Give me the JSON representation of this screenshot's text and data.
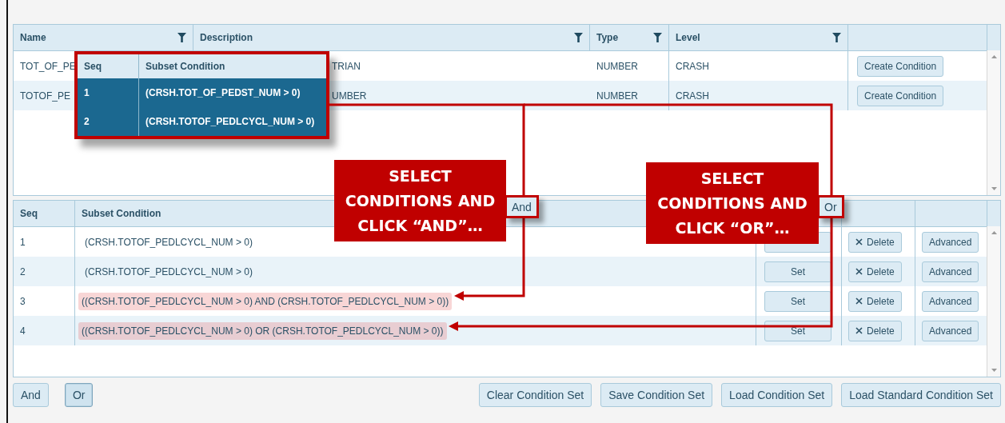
{
  "top_grid": {
    "columns": [
      {
        "label": "Name",
        "filter": true
      },
      {
        "label": "Description",
        "filter": true
      },
      {
        "label": "Type",
        "filter": true
      },
      {
        "label": "Level",
        "filter": true
      }
    ],
    "rows": [
      {
        "name": "TOT_OF_PE",
        "description": "TRIAN",
        "type": "NUMBER",
        "level": "CRASH",
        "action": "Create Condition"
      },
      {
        "name": "TOTOF_PE",
        "description": "UMBER",
        "type": "NUMBER",
        "level": "CRASH",
        "action": "Create Condition"
      }
    ]
  },
  "popup": {
    "columns": [
      "Seq",
      "Subset Condition"
    ],
    "rows": [
      {
        "seq": "1",
        "condition": "(CRSH.TOT_OF_PEDST_NUM > 0)",
        "selected": true
      },
      {
        "seq": "2",
        "condition": "(CRSH.TOTOF_PEDLCYCL_NUM > 0)",
        "selected": true
      }
    ]
  },
  "condition_grid": {
    "columns": [
      "Seq",
      "Subset Condition"
    ],
    "rows": [
      {
        "seq": "1",
        "condition": "(CRSH.TOTOF_PEDLCYCL_NUM > 0)",
        "highlighted": false,
        "delete": "Delete",
        "advanced": "Advanced"
      },
      {
        "seq": "2",
        "condition": "(CRSH.TOTOF_PEDLCYCL_NUM > 0)",
        "highlighted": false,
        "set": "Set",
        "delete": "Delete",
        "advanced": "Advanced"
      },
      {
        "seq": "3",
        "condition": "((CRSH.TOTOF_PEDLCYCL_NUM > 0) AND (CRSH.TOTOF_PEDLCYCL_NUM > 0))",
        "highlighted": true,
        "set": "Set",
        "delete": "Delete",
        "advanced": "Advanced"
      },
      {
        "seq": "4",
        "condition": "((CRSH.TOTOF_PEDLCYCL_NUM > 0) OR (CRSH.TOTOF_PEDLCYCL_NUM > 0))",
        "highlighted": true,
        "set": "Set",
        "delete": "Delete",
        "advanced": "Advanced"
      }
    ]
  },
  "callouts": [
    {
      "lines": [
        "SELECT",
        "CONDITIONS AND",
        "CLICK “AND”…"
      ],
      "button": "And"
    },
    {
      "lines": [
        "SELECT",
        "CONDITIONS AND",
        "CLICK “OR”…"
      ],
      "button": "Or"
    }
  ],
  "toolbar": {
    "left": [
      {
        "label": "And",
        "selected": false
      },
      {
        "label": "Or",
        "selected": true
      }
    ],
    "right": [
      "Clear Condition Set",
      "Save Condition Set",
      "Load Condition Set",
      "Load Standard Condition Set"
    ]
  }
}
